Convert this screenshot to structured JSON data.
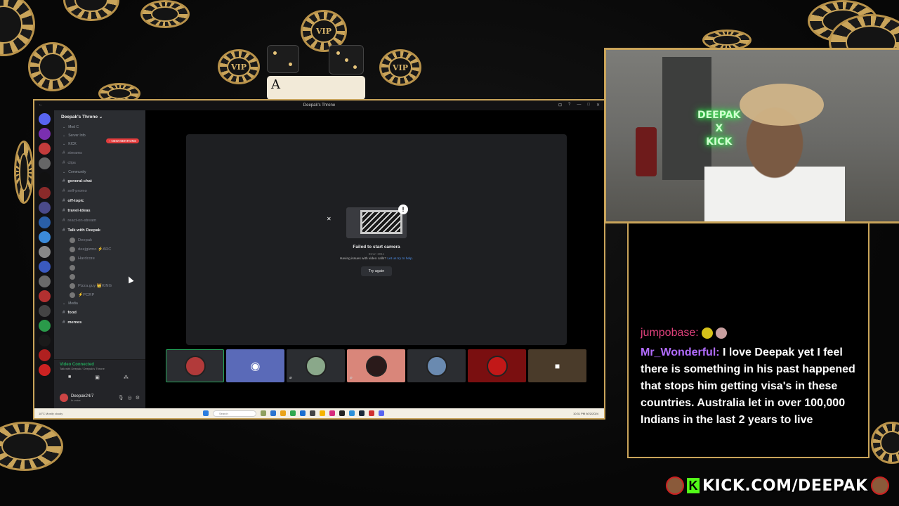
{
  "window": {
    "title": "Deepak's Throne",
    "controls": [
      "⊡",
      "?",
      "—",
      "□",
      "✕"
    ],
    "back": "←"
  },
  "server": {
    "name": "Deepak's Throne ⌄",
    "new_mentions": "↑ NEW MENTIONS"
  },
  "channels": [
    {
      "label": "Mod C",
      "kind": "cat"
    },
    {
      "label": "Server Info",
      "kind": "cat"
    },
    {
      "label": "KICK",
      "kind": "cat"
    },
    {
      "label": "streams",
      "kind": "dim"
    },
    {
      "label": "clips",
      "kind": "dim"
    },
    {
      "label": "Community",
      "kind": "cat"
    },
    {
      "label": "general-chat",
      "kind": "bright"
    },
    {
      "label": "self-promo",
      "kind": "dim"
    },
    {
      "label": "off-topic",
      "kind": "bright"
    },
    {
      "label": "travel-ideas",
      "kind": "bright"
    },
    {
      "label": "react-on-stream",
      "kind": "dim"
    },
    {
      "label": "Talk with Deepak",
      "kind": "bright"
    }
  ],
  "voice_users": [
    "Deepak",
    "deejgizmo ⚡ARC",
    "Hardcore",
    "",
    "",
    "Pizza.guy 👑KING",
    "⚡PCRP"
  ],
  "more_channels": [
    {
      "label": "Media",
      "kind": "cat"
    },
    {
      "label": "food",
      "kind": "bright"
    },
    {
      "label": "memes",
      "kind": "bright"
    }
  ],
  "voice_connected": {
    "title": "Video Connected",
    "sub": "Talk with Deepak / Deepak's Throne"
  },
  "user": {
    "name": "Deepak24/7",
    "status": "In voice"
  },
  "call": {
    "failed": "Failed to start camera",
    "error_code": "Error: 2011",
    "help_prefix": "Having issues with video calls?",
    "help_link": "Let us try to help.",
    "retry": "Try again"
  },
  "taskbar": {
    "weather": "18°C Mostly cloudy",
    "search": "Search",
    "clock": "10:31 PM 9/22/2024"
  },
  "webcam": {
    "neon_sign": [
      "DEEPAK",
      "X",
      "KICK"
    ]
  },
  "chat": [
    {
      "user": "jumpobase:",
      "text": ""
    },
    {
      "user": "Mr_Wonderful:",
      "text": "I love Deepak yet I feel there is something in his past happened that stops him getting visa's in these countries. Australia let in over 100,000 Indians in the last 2 years to live"
    }
  ],
  "banner": {
    "url": "KICK.COM/DEEPAK",
    "k": "K"
  },
  "colors": {
    "gold": "#c9a45a",
    "kick_green": "#53fc18",
    "discord_bg": "#2b2d31",
    "link_blue": "#4e8ee8",
    "user1": "#e0417c",
    "user2": "#b26cff"
  }
}
